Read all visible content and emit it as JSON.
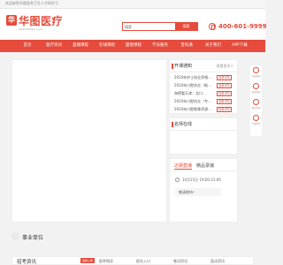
{
  "topbar": {
    "text": "欢迎来到华图医考卫生人才网学习"
  },
  "brand": {
    "logo_mark": "华",
    "name": "华图医疗",
    "sub": "www.htexam.com"
  },
  "search": {
    "value": "搜索",
    "button": "搜索"
  },
  "hotline": {
    "phone": "400-601-9999"
  },
  "nav": {
    "items": [
      "首页",
      "医疗资讯",
      "直播课程",
      "在线课程",
      "面授课程",
      "学员服务",
      "百校通",
      "关于我们",
      "APP下载"
    ]
  },
  "notice": {
    "title": "开课通知",
    "more": "查看更多>",
    "items": [
      {
        "text": "2024年护士执业资格...",
        "tag": "查看详情"
      },
      {
        "text": "2024年口腔执业（助...",
        "tag": "查看详情"
      },
      {
        "text": "海德看天津：北口...",
        "tag": "查看详情"
      },
      {
        "text": "2024年口腔执业（专...",
        "tag": "查看详情"
      },
      {
        "text": "2024年口腔影像资源...",
        "tag": "查看详情"
      }
    ]
  },
  "teacher": {
    "title": "名师在线"
  },
  "live": {
    "tab_active": "近期直播",
    "tab_other": "精品录播",
    "time": "10月15日 19:00-21:00",
    "bubble": "敬请期待！"
  },
  "tools": [
    {
      "icon": "chat-icon",
      "label": "在线咨询"
    },
    {
      "icon": "phone-icon",
      "label": "电话咨询"
    },
    {
      "icon": "wechat-icon",
      "label": "微信咨询"
    },
    {
      "icon": "app-icon",
      "label": "下载APP"
    }
  ],
  "unit": {
    "title": "事业单位"
  },
  "news": {
    "title": "招考资讯",
    "tag": "最新公告",
    "tabs": [
      "报考指导",
      "报名入口",
      "笔试资讯",
      "面试资讯"
    ]
  },
  "colors": {
    "brand": "#e64b3b"
  }
}
